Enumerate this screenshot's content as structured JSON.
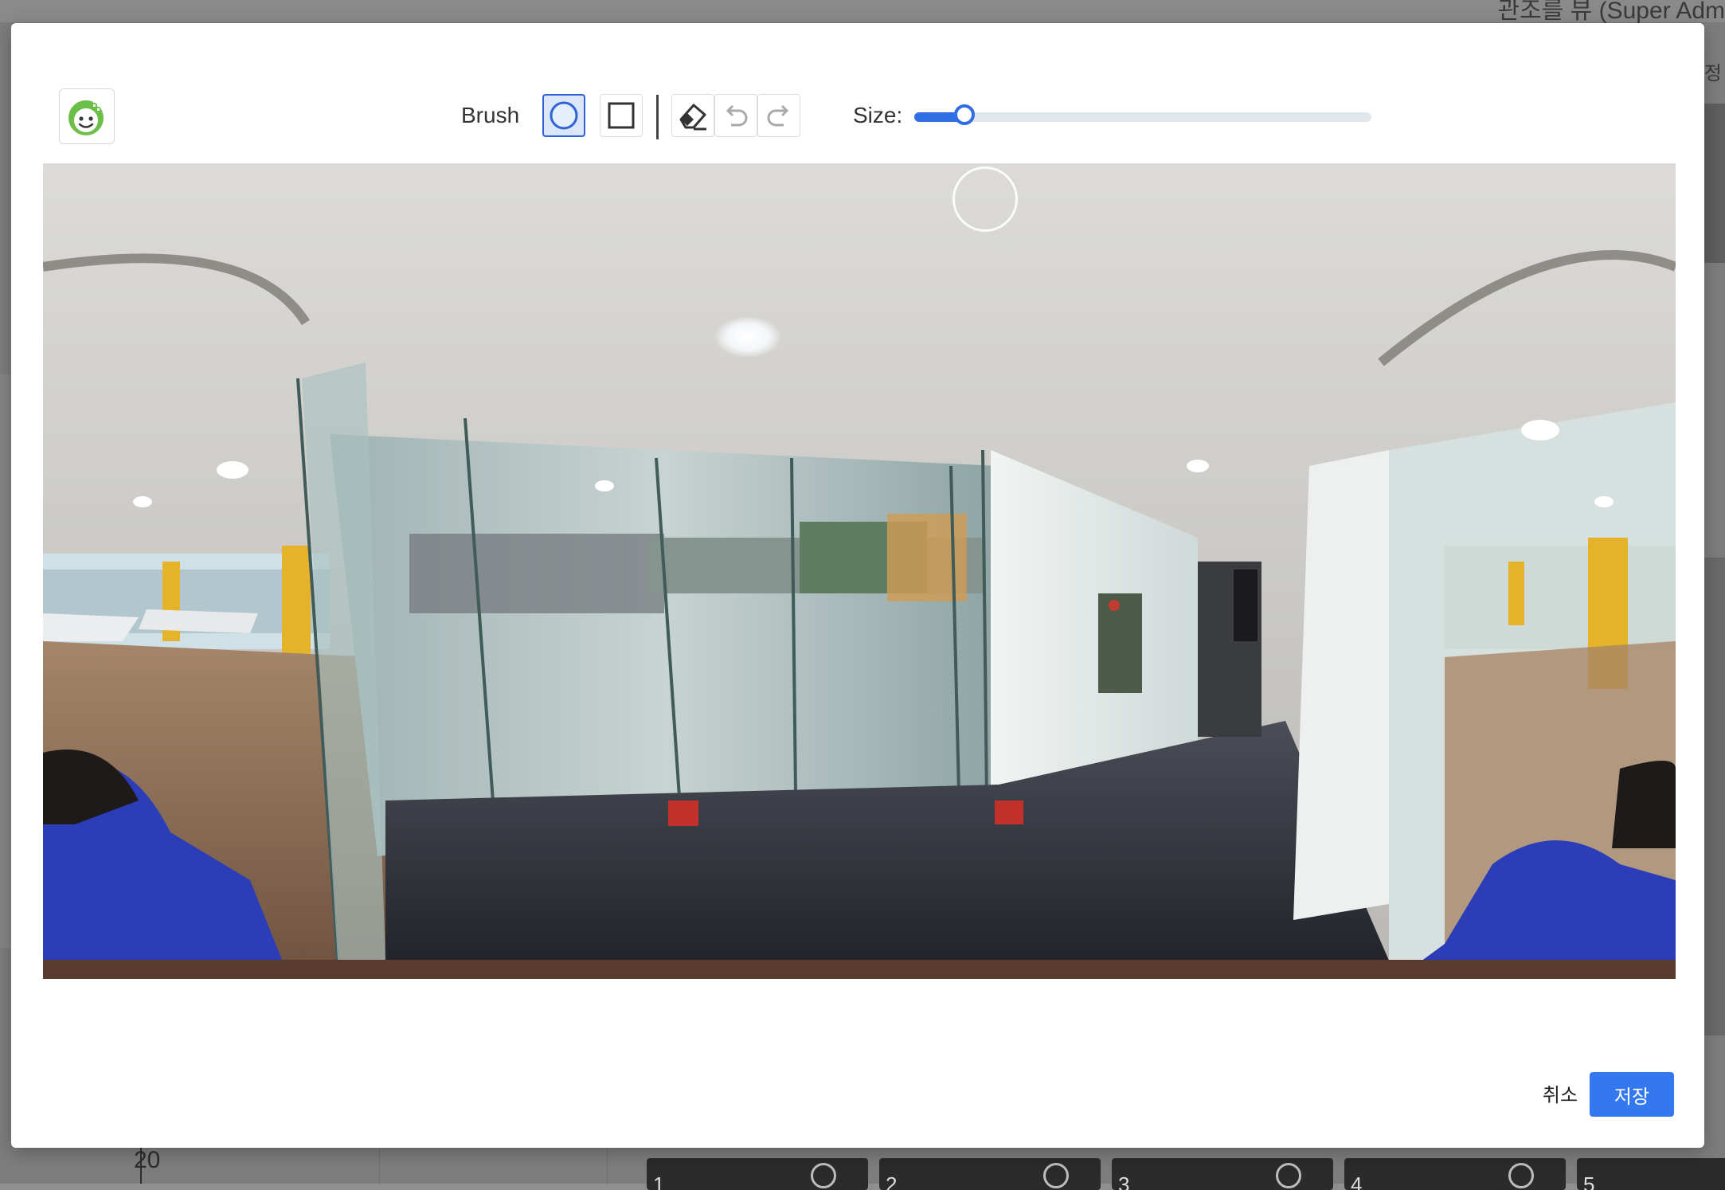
{
  "background": {
    "title": "관조를 뷰 (Super Adm",
    "side_label": "정",
    "ruler_value": "20",
    "thumbnails": [
      "1",
      "2",
      "3",
      "4",
      "5"
    ]
  },
  "modal": {
    "logo_icon": "smiley-face-logo-icon",
    "toolbar": {
      "brush_label": "Brush",
      "tools": [
        {
          "name": "circle-brush",
          "icon": "circle-icon",
          "active": true
        },
        {
          "name": "square-brush",
          "icon": "square-icon",
          "active": false
        },
        {
          "name": "eraser",
          "icon": "eraser-icon",
          "active": false
        },
        {
          "name": "undo",
          "icon": "undo-icon",
          "active": false
        },
        {
          "name": "redo",
          "icon": "redo-icon",
          "active": false
        }
      ],
      "size_label": "Size:",
      "size_value": 0.11
    },
    "footer": {
      "cancel_label": "취소",
      "save_label": "저장"
    }
  },
  "colors": {
    "accent": "#2f6fe3",
    "save_button": "#3478f0",
    "active_tool_bg": "#dbe6fb"
  }
}
